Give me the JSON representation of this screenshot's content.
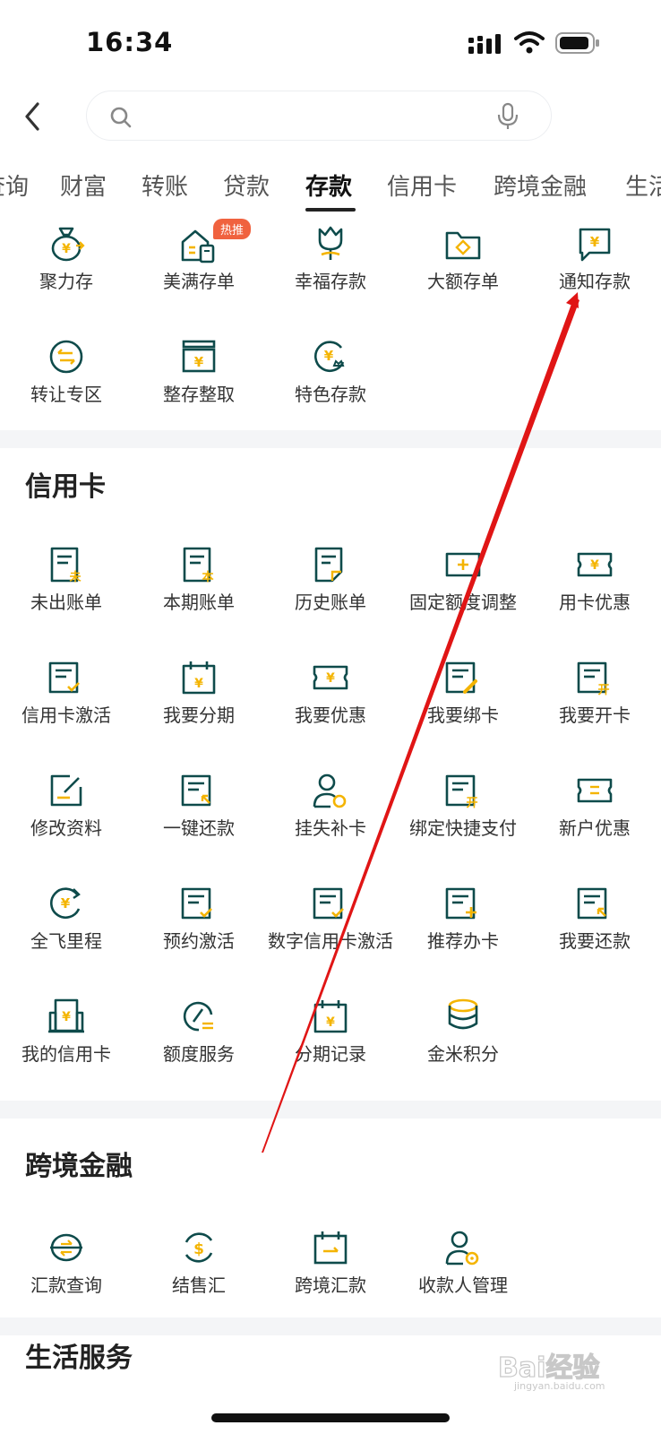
{
  "status": {
    "time": "16:34"
  },
  "search": {
    "placeholder": ""
  },
  "tabs": [
    "查询",
    "财富",
    "转账",
    "贷款",
    "存款",
    "信用卡",
    "跨境金融",
    "生活"
  ],
  "deposit": {
    "items": [
      {
        "label": "聚力存",
        "icon": "money-bag-icon"
      },
      {
        "label": "美满存单",
        "icon": "house-receipt-icon",
        "badge": "热推"
      },
      {
        "label": "幸福存款",
        "icon": "tulip-icon"
      },
      {
        "label": "大额存单",
        "icon": "folder-icon"
      },
      {
        "label": "通知存款",
        "icon": "message-yuan-icon"
      },
      {
        "label": "转让专区",
        "icon": "transfer-circle-icon"
      },
      {
        "label": "整存整取",
        "icon": "box-yuan-icon"
      },
      {
        "label": "特色存款",
        "icon": "yuan-crown-icon"
      }
    ]
  },
  "credit": {
    "title": "信用卡",
    "items": [
      {
        "label": "未出账单"
      },
      {
        "label": "本期账单"
      },
      {
        "label": "历史账单"
      },
      {
        "label": "固定额度调整"
      },
      {
        "label": "用卡优惠"
      },
      {
        "label": "信用卡激活"
      },
      {
        "label": "我要分期"
      },
      {
        "label": "我要优惠"
      },
      {
        "label": "我要绑卡"
      },
      {
        "label": "我要开卡"
      },
      {
        "label": "修改资料"
      },
      {
        "label": "一键还款"
      },
      {
        "label": "挂失补卡"
      },
      {
        "label": "绑定快捷支付"
      },
      {
        "label": "新户优惠"
      },
      {
        "label": "全飞里程"
      },
      {
        "label": "预约激活"
      },
      {
        "label": "数字信用卡激活"
      },
      {
        "label": "推荐办卡"
      },
      {
        "label": "我要还款"
      },
      {
        "label": "我的信用卡"
      },
      {
        "label": "额度服务"
      },
      {
        "label": "分期记录"
      },
      {
        "label": "金米积分"
      }
    ]
  },
  "crossborder": {
    "title": "跨境金融",
    "items": [
      {
        "label": "汇款查询"
      },
      {
        "label": "结售汇"
      },
      {
        "label": "跨境汇款"
      },
      {
        "label": "收款人管理"
      }
    ]
  },
  "life": {
    "title": "生活服务"
  },
  "watermark": {
    "brand": "Bai经验",
    "sub": "jingyan.baidu.com"
  },
  "colors": {
    "primary": "#0e4b4b",
    "accent": "#f4b400",
    "badge": "#f0623f",
    "annotation": "#e01515"
  }
}
